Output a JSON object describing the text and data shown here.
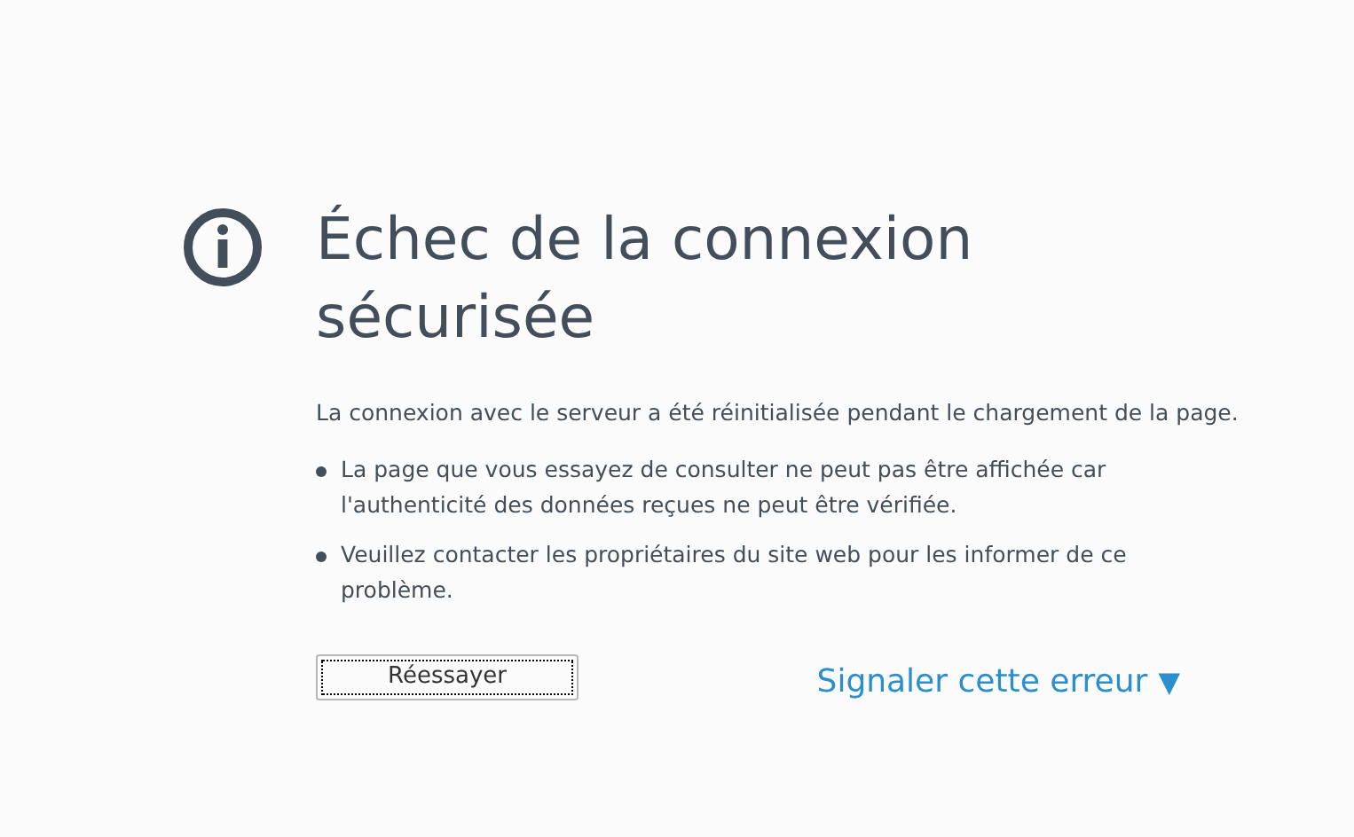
{
  "title": "Échec de la connexion sécurisée",
  "description": "La connexion avec le serveur a été réinitialisée pendant le chargement de la page.",
  "bullets": [
    "La page que vous essayez de consulter ne peut pas être affichée car l'authenticité des données reçues ne peut être vérifiée.",
    "Veuillez contacter les propriétaires du site web pour les informer de ce problème."
  ],
  "retry_button": {
    "label": "Réessayer"
  },
  "report_link": {
    "label": "Signaler cette erreur",
    "arrow": "▼"
  }
}
